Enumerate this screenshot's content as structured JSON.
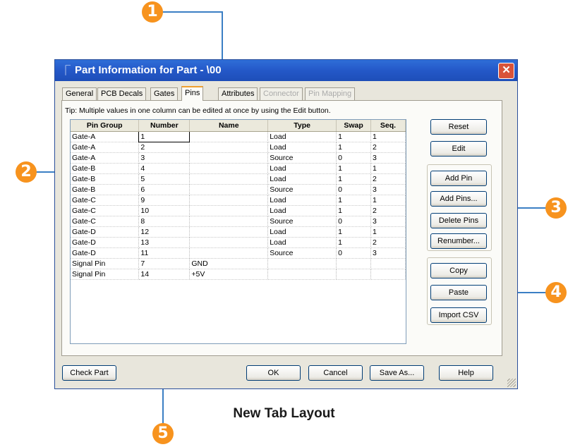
{
  "window": {
    "title": "Part Information for Part - \\00",
    "close_label": "✕"
  },
  "tabs": [
    {
      "label": "General",
      "state": "normal"
    },
    {
      "label": "PCB Decals",
      "state": "normal"
    },
    {
      "label": "Gates",
      "state": "normal"
    },
    {
      "label": "Pins",
      "state": "active"
    },
    {
      "label": "Attributes",
      "state": "normal"
    },
    {
      "label": "Connector",
      "state": "disabled"
    },
    {
      "label": "Pin Mapping",
      "state": "disabled"
    }
  ],
  "tip": "Tip: Multiple values in one column can be edited at once by using the Edit button.",
  "table": {
    "headers": [
      "Pin Group",
      "Number",
      "Name",
      "Type",
      "Swap",
      "Seq."
    ],
    "rows": [
      [
        "Gate-A",
        "1",
        "",
        "Load",
        "1",
        "1"
      ],
      [
        "Gate-A",
        "2",
        "",
        "Load",
        "1",
        "2"
      ],
      [
        "Gate-A",
        "3",
        "",
        "Source",
        "0",
        "3"
      ],
      [
        "Gate-B",
        "4",
        "",
        "Load",
        "1",
        "1"
      ],
      [
        "Gate-B",
        "5",
        "",
        "Load",
        "1",
        "2"
      ],
      [
        "Gate-B",
        "6",
        "",
        "Source",
        "0",
        "3"
      ],
      [
        "Gate-C",
        "9",
        "",
        "Load",
        "1",
        "1"
      ],
      [
        "Gate-C",
        "10",
        "",
        "Load",
        "1",
        "2"
      ],
      [
        "Gate-C",
        "8",
        "",
        "Source",
        "0",
        "3"
      ],
      [
        "Gate-D",
        "12",
        "",
        "Load",
        "1",
        "1"
      ],
      [
        "Gate-D",
        "13",
        "",
        "Load",
        "1",
        "2"
      ],
      [
        "Gate-D",
        "11",
        "",
        "Source",
        "0",
        "3"
      ],
      [
        "Signal Pin",
        "7",
        "GND",
        "",
        "",
        ""
      ],
      [
        "Signal Pin",
        "14",
        "+5V",
        "",
        "",
        ""
      ]
    ]
  },
  "side_buttons": {
    "reset": "Reset",
    "edit": "Edit",
    "add_pin": "Add Pin",
    "add_pins": "Add Pins...",
    "delete_pins": "Delete Pins",
    "renumber": "Renumber...",
    "copy": "Copy",
    "paste": "Paste",
    "import_csv": "Import CSV"
  },
  "footer_buttons": {
    "check_part": "Check Part",
    "ok": "OK",
    "cancel": "Cancel",
    "save_as": "Save As...",
    "help": "Help"
  },
  "callouts": [
    "1",
    "2",
    "3",
    "4",
    "5"
  ],
  "caption": "New Tab Layout",
  "colors": {
    "callout": "#f7931e",
    "leader_line": "#3b7fc4",
    "titlebar": "#2458c8"
  }
}
